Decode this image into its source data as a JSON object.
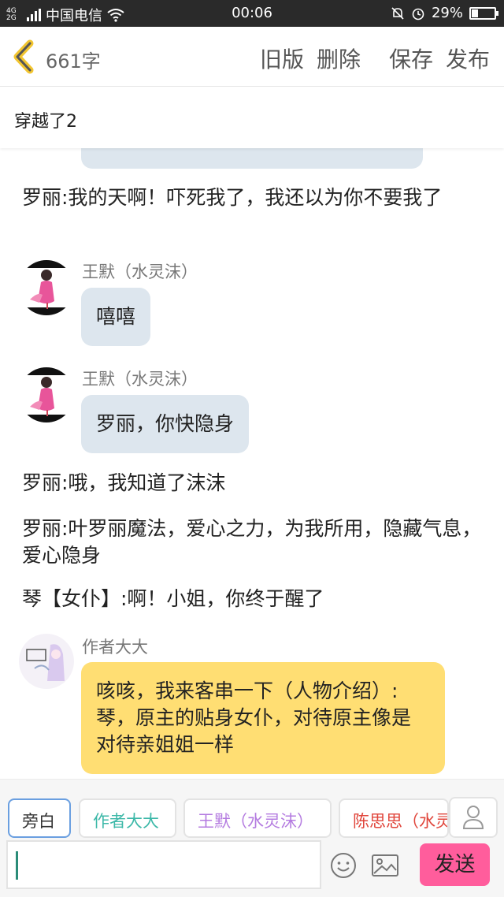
{
  "status_bar": {
    "network": "4G",
    "network2": "2G",
    "carrier": "中国电信",
    "time": "00:06",
    "battery": "29%"
  },
  "header": {
    "word_count": "661字",
    "actions": {
      "old_version": "旧版",
      "delete": "删除",
      "save": "保存",
      "publish": "发布"
    }
  },
  "chapter_title": "穿越了2",
  "messages": [
    {
      "type": "narration",
      "text": "罗丽:我的天啊！吓死我了，我还以为你不要我了"
    },
    {
      "type": "speech",
      "speaker": "王默（水灵沫）",
      "text": "嘻嘻"
    },
    {
      "type": "speech",
      "speaker": "王默（水灵沫）",
      "text": "罗丽，你快隐身"
    },
    {
      "type": "narration",
      "text": "罗丽:哦，我知道了沫沫"
    },
    {
      "type": "narration",
      "text": "罗丽:叶罗丽魔法，爱心之力，为我所用，隐藏气息，爱心隐身"
    },
    {
      "type": "narration",
      "text": "琴【女仆】:啊！小姐，你终于醒了"
    },
    {
      "type": "speech",
      "speaker": "作者大大",
      "text": "咳咳，我来客串一下（人物介绍）:琴，原主的贴身女仆，对待原主像是对待亲姐姐一样"
    }
  ],
  "roles": [
    "旁白",
    "作者大大",
    "王默（水灵沫）",
    "陈思思（水灵"
  ],
  "input": {
    "value": ""
  },
  "send_label": "发送",
  "colors": {
    "bubble": "#dde6ee",
    "author_bubble": "#ffde73",
    "send": "#ff5d9c",
    "selected_border": "#6a9fe0"
  },
  "icons": {
    "back": "chevron-left-icon",
    "emoji": "smiley-icon",
    "image": "image-icon",
    "person": "person-icon"
  }
}
